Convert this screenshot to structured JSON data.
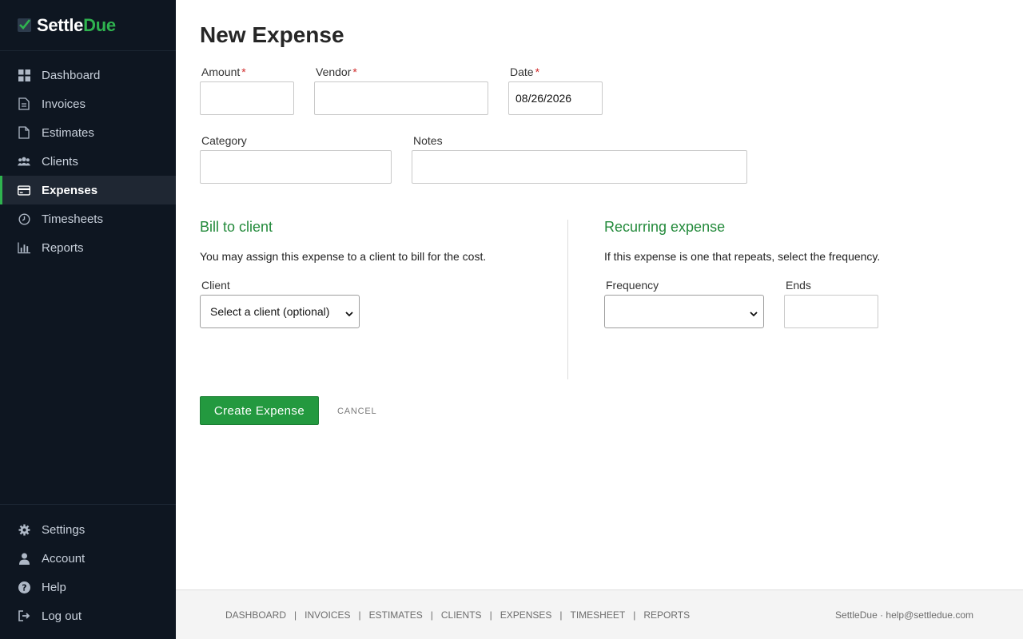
{
  "brand": {
    "name_part1": "Settle",
    "name_part2": "Due",
    "accent_color": "#2fb34f"
  },
  "sidebar": {
    "items": [
      {
        "label": "Dashboard",
        "icon": "dashboard-icon"
      },
      {
        "label": "Invoices",
        "icon": "invoice-icon"
      },
      {
        "label": "Estimates",
        "icon": "document-icon"
      },
      {
        "label": "Clients",
        "icon": "users-icon"
      },
      {
        "label": "Expenses",
        "icon": "credit-card-icon",
        "active": true
      },
      {
        "label": "Timesheets",
        "icon": "clock-icon"
      },
      {
        "label": "Reports",
        "icon": "bar-chart-icon"
      }
    ],
    "bottom_items": [
      {
        "label": "Settings",
        "icon": "gear-icon"
      },
      {
        "label": "Account",
        "icon": "user-icon"
      },
      {
        "label": "Help",
        "icon": "help-icon"
      },
      {
        "label": "Log out",
        "icon": "logout-icon"
      }
    ]
  },
  "main": {
    "title": "New Expense",
    "fields": {
      "amount": {
        "label": "Amount",
        "required_mark": "*",
        "value": ""
      },
      "vendor": {
        "label": "Vendor",
        "required_mark": "*",
        "value": ""
      },
      "date": {
        "label": "Date",
        "required_mark": "*",
        "value": "08/26/2026"
      },
      "category": {
        "label": "Category",
        "value": ""
      },
      "notes": {
        "label": "Notes",
        "value": ""
      }
    },
    "bill_to_client": {
      "title": "Bill to client",
      "description": "You may assign this expense to a client to bill for the cost.",
      "client_label": "Client",
      "client_selected": "Select a client (optional)"
    },
    "recurring": {
      "title": "Recurring expense",
      "description": "If this expense is one that repeats, select the frequency.",
      "frequency_label": "Frequency",
      "frequency_selected": "",
      "ends_label": "Ends",
      "ends_value": ""
    },
    "actions": {
      "create_label": "Create Expense",
      "cancel_label": "CANCEL"
    }
  },
  "footer": {
    "links": [
      "DASHBOARD",
      "INVOICES",
      "ESTIMATES",
      "CLIENTS",
      "EXPENSES",
      "TIMESHEET",
      "REPORTS"
    ],
    "separator": "|",
    "right_text": "SettleDue · help@settledue.com"
  },
  "colors": {
    "sidebar_bg": "#0e1621",
    "primary_green": "#23993f",
    "section_title_green": "#238a3b"
  }
}
